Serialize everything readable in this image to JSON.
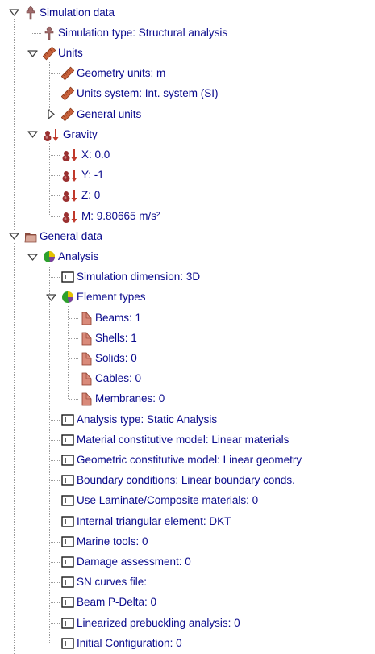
{
  "tree": [
    {
      "id": "simulation-data",
      "depth": 0,
      "expander": "expanded",
      "icon": "pin-icon",
      "label": "Simulation data"
    },
    {
      "id": "simulation-type",
      "depth": 1,
      "expander": "none",
      "icon": "pin-icon",
      "label": "Simulation type: Structural analysis"
    },
    {
      "id": "units",
      "depth": 1,
      "expander": "expanded",
      "icon": "ruler-icon",
      "label": "Units"
    },
    {
      "id": "geometry-units",
      "depth": 2,
      "expander": "none",
      "icon": "ruler-icon",
      "label": "Geometry units: m"
    },
    {
      "id": "units-system",
      "depth": 2,
      "expander": "none",
      "icon": "ruler-icon",
      "label": "Units system: Int. system (SI)"
    },
    {
      "id": "general-units",
      "depth": 2,
      "expander": "collapsed",
      "icon": "ruler-icon",
      "label": "General units"
    },
    {
      "id": "gravity",
      "depth": 1,
      "expander": "expanded",
      "icon": "gravity-icon",
      "label": "Gravity"
    },
    {
      "id": "gravity-x",
      "depth": 2,
      "expander": "none",
      "icon": "gravity-icon",
      "label": "X: 0.0"
    },
    {
      "id": "gravity-y",
      "depth": 2,
      "expander": "none",
      "icon": "gravity-icon",
      "label": "Y: -1"
    },
    {
      "id": "gravity-z",
      "depth": 2,
      "expander": "none",
      "icon": "gravity-icon",
      "label": "Z: 0"
    },
    {
      "id": "gravity-m",
      "depth": 2,
      "expander": "none",
      "icon": "gravity-icon",
      "label": "M: 9.80665 m/s²"
    },
    {
      "id": "general-data",
      "depth": 0,
      "expander": "expanded",
      "icon": "folder-icon",
      "label": "General data"
    },
    {
      "id": "analysis",
      "depth": 1,
      "expander": "expanded",
      "icon": "pie-icon",
      "label": "Analysis"
    },
    {
      "id": "simulation-dimension",
      "depth": 2,
      "expander": "none",
      "icon": "field-icon",
      "label": "Simulation dimension: 3D"
    },
    {
      "id": "element-types",
      "depth": 2,
      "expander": "expanded",
      "icon": "pie-icon",
      "label": "Element types"
    },
    {
      "id": "beams",
      "depth": 3,
      "expander": "none",
      "icon": "element-icon",
      "label": "Beams: 1"
    },
    {
      "id": "shells",
      "depth": 3,
      "expander": "none",
      "icon": "element-icon",
      "label": "Shells: 1"
    },
    {
      "id": "solids",
      "depth": 3,
      "expander": "none",
      "icon": "element-icon",
      "label": "Solids: 0"
    },
    {
      "id": "cables",
      "depth": 3,
      "expander": "none",
      "icon": "element-icon",
      "label": "Cables: 0"
    },
    {
      "id": "membranes",
      "depth": 3,
      "expander": "none",
      "icon": "element-icon",
      "label": "Membranes: 0"
    },
    {
      "id": "analysis-type",
      "depth": 2,
      "expander": "none",
      "icon": "field-icon",
      "label": "Analysis type: Static Analysis"
    },
    {
      "id": "material-constitutive-model",
      "depth": 2,
      "expander": "none",
      "icon": "field-icon",
      "label": "Material constitutive model: Linear materials"
    },
    {
      "id": "geometric-constitutive-model",
      "depth": 2,
      "expander": "none",
      "icon": "field-icon",
      "label": "Geometric constitutive model: Linear geometry"
    },
    {
      "id": "boundary-conditions",
      "depth": 2,
      "expander": "none",
      "icon": "field-icon",
      "label": "Boundary conditions: Linear boundary conds."
    },
    {
      "id": "use-laminate",
      "depth": 2,
      "expander": "none",
      "icon": "field-icon",
      "label": "Use Laminate/Composite materials: 0"
    },
    {
      "id": "internal-triangular-element",
      "depth": 2,
      "expander": "none",
      "icon": "field-icon",
      "label": "Internal triangular element: DKT"
    },
    {
      "id": "marine-tools",
      "depth": 2,
      "expander": "none",
      "icon": "field-icon",
      "label": "Marine tools: 0"
    },
    {
      "id": "damage-assessment",
      "depth": 2,
      "expander": "none",
      "icon": "field-icon",
      "label": "Damage assessment: 0"
    },
    {
      "id": "sn-curves-file",
      "depth": 2,
      "expander": "none",
      "icon": "field-icon",
      "label": "SN curves file:"
    },
    {
      "id": "beam-p-delta",
      "depth": 2,
      "expander": "none",
      "icon": "field-icon",
      "label": "Beam P-Delta: 0"
    },
    {
      "id": "linearized-prebuckling",
      "depth": 2,
      "expander": "none",
      "icon": "field-icon",
      "label": "Linearized prebuckling analysis: 0"
    },
    {
      "id": "initial-configuration",
      "depth": 2,
      "expander": "none",
      "icon": "field-icon",
      "label": "Initial Configuration: 0"
    }
  ],
  "colors": {
    "label": "#0a0a8c",
    "connector": "#9a9a9a",
    "expander": "#404040",
    "pin": "#a06b6b",
    "ruler_body": "#c8623c",
    "ruler_edge": "#8a3a1c",
    "folder_back": "#8a4a3c",
    "folder_front": "#d8a89a",
    "gravity_ball": "#9a3030",
    "gravity_arrow": "#c0392b",
    "pie_green": "#2ca02c",
    "pie_yellow": "#e6c300",
    "pie_purple": "#7b3f9e",
    "element_fill": "#d98a7a",
    "element_edge": "#8a3a2a",
    "field_frame": "#1a1a1a"
  }
}
